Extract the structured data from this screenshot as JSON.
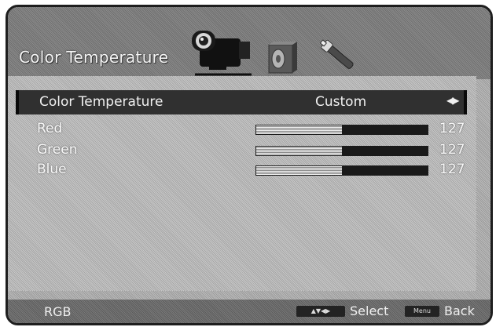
{
  "header": {
    "title": "Color Temperature",
    "icons": [
      "camcorder-icon",
      "speaker-icon",
      "wrench-icon"
    ]
  },
  "selected_setting": {
    "label": "Color Temperature",
    "value": "Custom",
    "arrows": "◀▶"
  },
  "adjustments": [
    {
      "label": "Red",
      "value": "127",
      "level": 0.5
    },
    {
      "label": "Green",
      "value": "127",
      "level": 0.5
    },
    {
      "label": "Blue",
      "value": "127",
      "level": 0.5
    }
  ],
  "footer": {
    "left_label": "RGB",
    "nav_key": "▲▼◀▶",
    "select_label": "Select",
    "menu_key": "Menu",
    "back_label": "Back"
  },
  "colors": {
    "frame": "#1e1e1e",
    "highlight_row": "#303030",
    "text": "#f0f0f0"
  }
}
